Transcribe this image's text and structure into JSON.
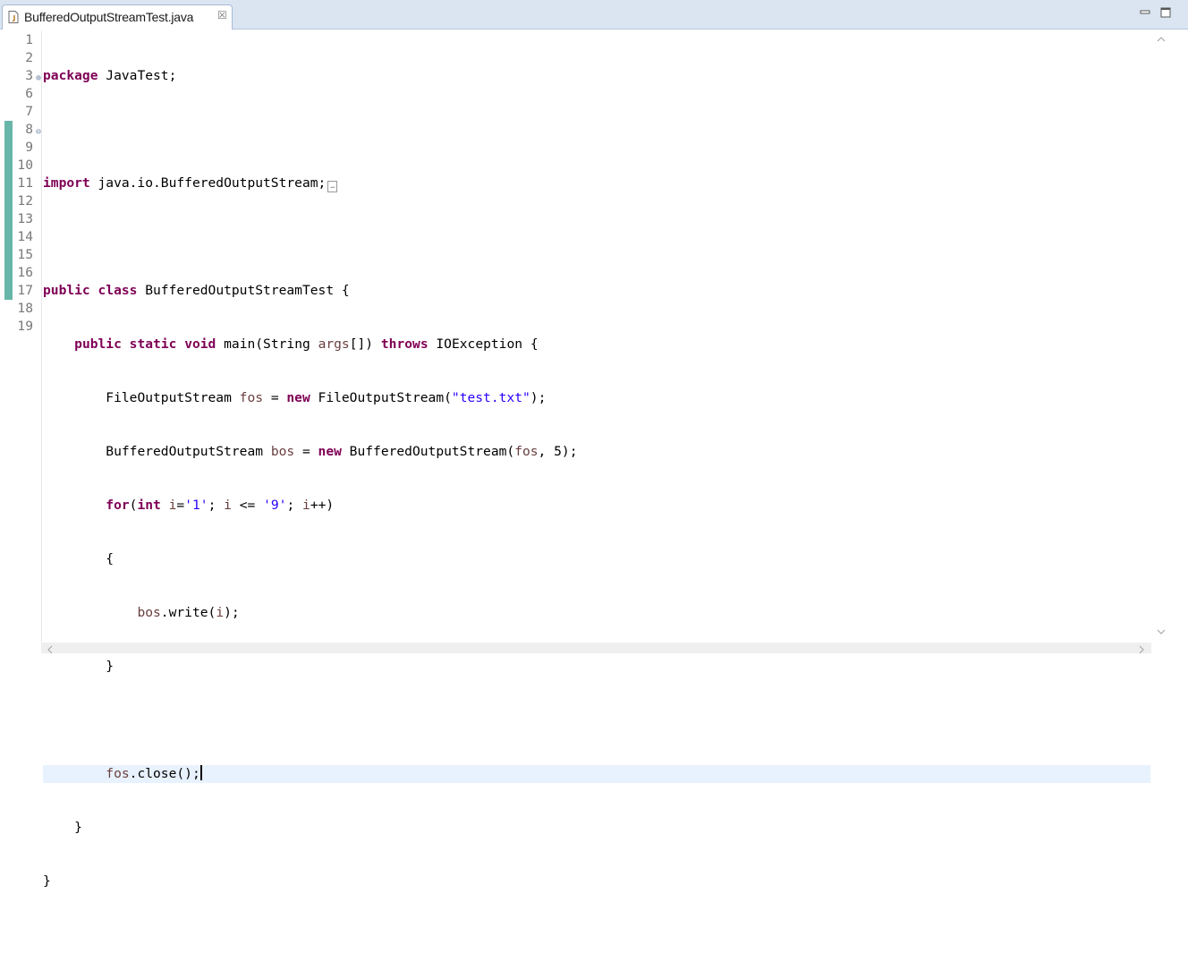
{
  "tab": {
    "filename": "BufferedOutputStreamTest.java",
    "close_glyph": "☒"
  },
  "window": {
    "minimize_icon": "minimize-icon",
    "maximize_icon": "maximize-icon"
  },
  "editor": {
    "line_numbers": [
      "1",
      "2",
      "3",
      "6",
      "7",
      "8",
      "9",
      "10",
      "11",
      "12",
      "13",
      "14",
      "15",
      "16",
      "17",
      "18",
      "19"
    ],
    "fold_markers": {
      "3": "⊕",
      "8": "⊖"
    },
    "current_line": "16"
  },
  "colors": {
    "keyword": "#7f0055",
    "string": "#2a00ff",
    "variable": "#6a3e3e",
    "current_line_bg": "#e8f2fe",
    "change_bar": "#4da89a"
  },
  "code": {
    "l1": {
      "kw": "package",
      "rest": " JavaTest;"
    },
    "l3": {
      "kw": "import",
      "rest": " java.io.BufferedOutputStream;"
    },
    "l7": {
      "kw1": "public",
      "kw2": "class",
      "rest": " BufferedOutputStreamTest {"
    },
    "l8": {
      "kw1": "public",
      "kw2": "static",
      "kw3": "void",
      "t1": " main(String ",
      "v1": "args",
      "t2": "[]) ",
      "kw4": "throws",
      "t3": " IOException {"
    },
    "l9": {
      "t1": "FileOutputStream ",
      "v1": "fos",
      "t2": " = ",
      "kw": "new",
      "t3": " FileOutputStream(",
      "s1": "\"test.txt\"",
      "t4": ");"
    },
    "l10": {
      "t1": "BufferedOutputStream ",
      "v1": "bos",
      "t2": " = ",
      "kw": "new",
      "t3": " BufferedOutputStream(",
      "v2": "fos",
      "t4": ", 5);"
    },
    "l11": {
      "kw1": "for",
      "t1": "(",
      "kw2": "int",
      "t2": " ",
      "v1": "i",
      "t3": "=",
      "s1": "'1'",
      "t4": "; ",
      "v2": "i",
      "t5": " <= ",
      "s2": "'9'",
      "t6": "; ",
      "v3": "i",
      "t7": "++)"
    },
    "l12": {
      "t1": "{"
    },
    "l13": {
      "v1": "bos",
      "t1": ".write(",
      "v2": "i",
      "t2": ");"
    },
    "l14": {
      "t1": "}"
    },
    "l16": {
      "v1": "fos",
      "t1": ".close();"
    },
    "l17": {
      "t1": "}"
    },
    "l18": {
      "t1": "}"
    }
  }
}
